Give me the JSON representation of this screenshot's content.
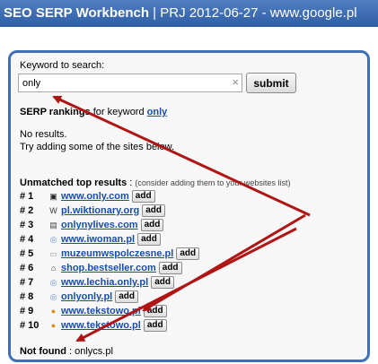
{
  "window": {
    "app_name": "SEO SERP Workbench",
    "separator": " | ",
    "project": "PRJ 2012-06-27 - www.google.pl"
  },
  "search": {
    "label": "Keyword to search:",
    "value": "only",
    "clear_symbol": "×",
    "submit_label": "submit"
  },
  "serp": {
    "heading": "SERP rankings",
    "for_keyword_text": "for keyword",
    "keyword": "only",
    "no_results": "No results.",
    "hint": "Try adding some of the sites below."
  },
  "unmatched": {
    "heading": "Unmatched top results",
    "colon": " : ",
    "note": "(consider adding them to your websites list)",
    "add_label": "add",
    "items": [
      {
        "rank": "# 1",
        "site": "www.only.com",
        "icon": "square-logo-icon"
      },
      {
        "rank": "# 2",
        "site": "pl.wiktionary.org",
        "icon": "wiktionary-icon"
      },
      {
        "rank": "# 3",
        "site": "onlynylives.com",
        "icon": "news-icon"
      },
      {
        "rank": "# 4",
        "site": "www.iwoman.pl",
        "icon": "globe-icon"
      },
      {
        "rank": "# 5",
        "site": "muzeumwspolczesne.pl",
        "icon": "blank-page-icon"
      },
      {
        "rank": "# 6",
        "site": "shop.bestseller.com",
        "icon": "house-icon"
      },
      {
        "rank": "# 7",
        "site": "www.lechia.only.pl",
        "icon": "globe-icon"
      },
      {
        "rank": "# 8",
        "site": "onlyonly.pl",
        "icon": "globe-icon"
      },
      {
        "rank": "# 9",
        "site": "www.tekstowo.pl",
        "icon": "orange-logo-icon"
      },
      {
        "rank": "# 10",
        "site": "www.tekstowo.pl",
        "icon": "orange-logo-icon"
      }
    ]
  },
  "not_found": {
    "label": "Not found",
    "colon": " : ",
    "value": "onlycs.pl"
  },
  "colors": {
    "titlebar": "#2f5ea5",
    "border": "#3f6fb5",
    "link": "#1a4fa0",
    "arrow": "#b01515"
  }
}
